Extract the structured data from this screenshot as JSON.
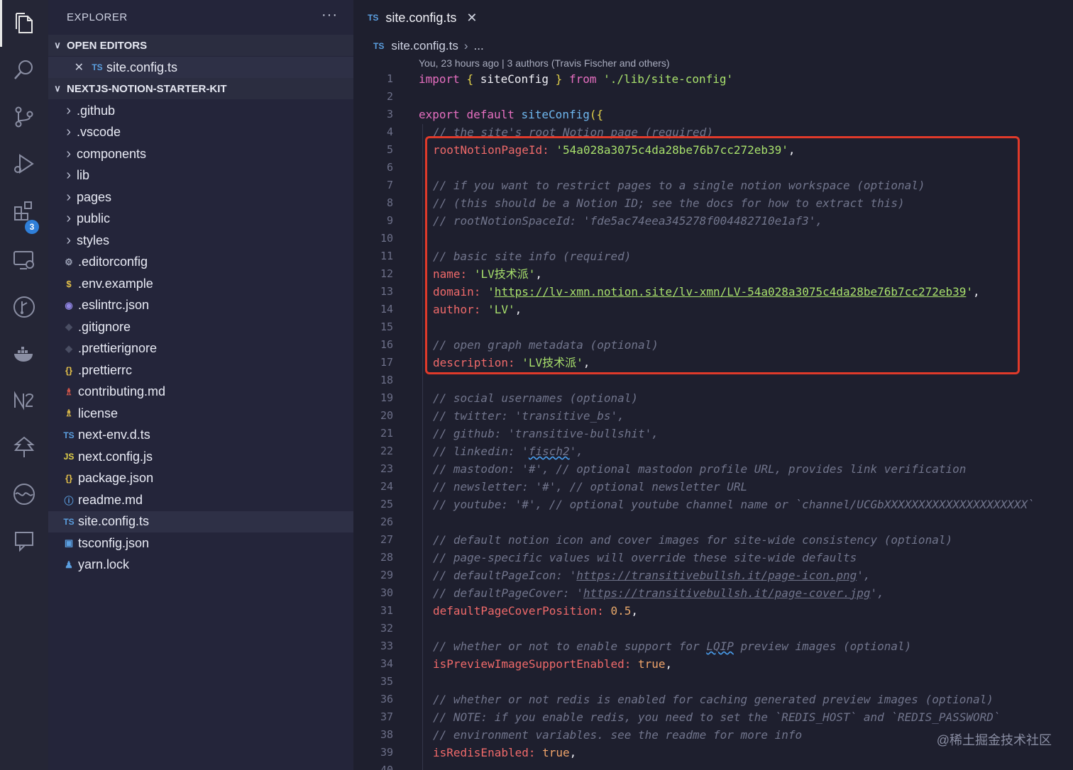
{
  "sidebar": {
    "title": "EXPLORER",
    "more": "···",
    "open_editors_label": "OPEN EDITORS",
    "open_editors": [
      {
        "icon_label": "TS",
        "icon": "typescript-icon",
        "name": "site.config.ts"
      }
    ],
    "project_label": "NEXTJS-NOTION-STARTER-KIT",
    "items": [
      {
        "kind": "folder",
        "name": ".github"
      },
      {
        "kind": "folder",
        "name": ".vscode"
      },
      {
        "kind": "folder",
        "name": "components"
      },
      {
        "kind": "folder",
        "name": "lib"
      },
      {
        "kind": "folder",
        "name": "pages"
      },
      {
        "kind": "folder",
        "name": "public"
      },
      {
        "kind": "folder",
        "name": "styles"
      },
      {
        "kind": "file",
        "icon": "gear-icon",
        "glyph": "⚙",
        "name": ".editorconfig"
      },
      {
        "kind": "file",
        "icon": "dollar-icon",
        "glyph": "$",
        "name": ".env.example"
      },
      {
        "kind": "file",
        "icon": "eslint-icon",
        "glyph": "◉",
        "name": ".eslintrc.json"
      },
      {
        "kind": "file",
        "icon": "git-icon",
        "glyph": "◆",
        "name": ".gitignore"
      },
      {
        "kind": "file",
        "icon": "prettier-icon",
        "glyph": "◆",
        "name": ".prettierignore"
      },
      {
        "kind": "file",
        "icon": "json-icon",
        "glyph": "{}",
        "name": ".prettierrc"
      },
      {
        "kind": "file",
        "icon": "markdown-person-icon",
        "glyph": "♗",
        "name": "contributing.md"
      },
      {
        "kind": "file",
        "icon": "license-icon",
        "glyph": "♗",
        "name": "license"
      },
      {
        "kind": "file",
        "icon": "typescript-icon",
        "glyph": "TS",
        "name": "next-env.d.ts"
      },
      {
        "kind": "file",
        "icon": "javascript-icon",
        "glyph": "JS",
        "name": "next.config.js"
      },
      {
        "kind": "file",
        "icon": "json-icon",
        "glyph": "{}",
        "name": "package.json"
      },
      {
        "kind": "file",
        "icon": "info-icon",
        "glyph": "ⓘ",
        "name": "readme.md"
      },
      {
        "kind": "file",
        "icon": "typescript-icon",
        "glyph": "TS",
        "name": "site.config.ts",
        "selected": true
      },
      {
        "kind": "file",
        "icon": "tsconfig-icon",
        "glyph": "▣",
        "name": "tsconfig.json"
      },
      {
        "kind": "file",
        "icon": "yarn-icon",
        "glyph": "♟",
        "name": "yarn.lock"
      }
    ]
  },
  "activity": {
    "extensions_badge": "3"
  },
  "editor": {
    "tab": {
      "icon_label": "TS",
      "name": "site.config.ts",
      "close": "✕"
    },
    "breadcrumb": {
      "icon_label": "TS",
      "file": "site.config.ts",
      "sep": "›",
      "rest": "..."
    },
    "blame": "You, 23 hours ago | 3 authors (Travis Fischer and others)",
    "lines": [
      {
        "n": "1",
        "indent": 0,
        "tokens": [
          [
            "kw",
            "import"
          ],
          [
            "id",
            " "
          ],
          [
            "br",
            "{"
          ],
          [
            "id",
            " siteConfig "
          ],
          [
            "br",
            "}"
          ],
          [
            "id",
            " "
          ],
          [
            "kw",
            "from"
          ],
          [
            "id",
            " "
          ],
          [
            "str",
            "'./lib/site-config'"
          ]
        ]
      },
      {
        "n": "2",
        "indent": 0,
        "tokens": []
      },
      {
        "n": "3",
        "indent": 0,
        "tokens": [
          [
            "kw",
            "export"
          ],
          [
            "id",
            " "
          ],
          [
            "kw",
            "default"
          ],
          [
            "id",
            " "
          ],
          [
            "fn",
            "siteConfig"
          ],
          [
            "br",
            "({"
          ]
        ]
      },
      {
        "n": "4",
        "indent": 1,
        "tokens": [
          [
            "cm",
            "// the site's root Notion page (required)"
          ]
        ]
      },
      {
        "n": "5",
        "indent": 1,
        "tokens": [
          [
            "prop",
            "rootNotionPageId:"
          ],
          [
            "id",
            " "
          ],
          [
            "str",
            "'54a028a3075c4da28be76b7cc272eb39'"
          ],
          [
            "id",
            ","
          ]
        ]
      },
      {
        "n": "6",
        "indent": 1,
        "tokens": []
      },
      {
        "n": "7",
        "indent": 1,
        "tokens": [
          [
            "cm",
            "// if you want to restrict pages to a single notion workspace (optional)"
          ]
        ]
      },
      {
        "n": "8",
        "indent": 1,
        "tokens": [
          [
            "cm",
            "// (this should be a Notion ID; see the docs for how to extract this)"
          ]
        ]
      },
      {
        "n": "9",
        "indent": 1,
        "tokens": [
          [
            "cm",
            "// rootNotionSpaceId: 'fde5ac74eea345278f004482710e1af3',"
          ]
        ]
      },
      {
        "n": "10",
        "indent": 1,
        "tokens": []
      },
      {
        "n": "11",
        "indent": 1,
        "tokens": [
          [
            "cm",
            "// basic site info (required)"
          ]
        ]
      },
      {
        "n": "12",
        "indent": 1,
        "tokens": [
          [
            "prop",
            "name:"
          ],
          [
            "id",
            " "
          ],
          [
            "str",
            "'LV技术派'"
          ],
          [
            "id",
            ","
          ]
        ]
      },
      {
        "n": "13",
        "indent": 1,
        "tokens": [
          [
            "prop",
            "domain:"
          ],
          [
            "id",
            " "
          ],
          [
            "str",
            "'"
          ],
          [
            "str url",
            "https://lv-xmn.notion.site/lv-xmn/LV-54a028a3075c4da28be76b7cc272eb39"
          ],
          [
            "str",
            "'"
          ],
          [
            "id",
            ","
          ]
        ]
      },
      {
        "n": "14",
        "indent": 1,
        "tokens": [
          [
            "prop",
            "author:"
          ],
          [
            "id",
            " "
          ],
          [
            "str",
            "'LV'"
          ],
          [
            "id",
            ","
          ]
        ]
      },
      {
        "n": "15",
        "indent": 1,
        "tokens": []
      },
      {
        "n": "16",
        "indent": 1,
        "tokens": [
          [
            "cm",
            "// open graph metadata (optional)"
          ]
        ]
      },
      {
        "n": "17",
        "indent": 1,
        "tokens": [
          [
            "prop",
            "description:"
          ],
          [
            "id",
            " "
          ],
          [
            "str",
            "'LV技术派'"
          ],
          [
            "id",
            ","
          ]
        ]
      },
      {
        "n": "18",
        "indent": 1,
        "tokens": []
      },
      {
        "n": "19",
        "indent": 1,
        "tokens": [
          [
            "cm",
            "// social usernames (optional)"
          ]
        ]
      },
      {
        "n": "20",
        "indent": 1,
        "tokens": [
          [
            "cm",
            "// twitter: 'transitive_bs',"
          ]
        ]
      },
      {
        "n": "21",
        "indent": 1,
        "tokens": [
          [
            "cm",
            "// github: 'transitive-bullshit',"
          ]
        ]
      },
      {
        "n": "22",
        "indent": 1,
        "tokens": [
          [
            "cm",
            "// linkedin: '"
          ],
          [
            "cm squig",
            "fisch2"
          ],
          [
            "cm",
            "',"
          ]
        ]
      },
      {
        "n": "23",
        "indent": 1,
        "tokens": [
          [
            "cm",
            "// mastodon: '#', // optional mastodon profile URL, provides link verification"
          ]
        ]
      },
      {
        "n": "24",
        "indent": 1,
        "tokens": [
          [
            "cm",
            "// newsletter: '#', // optional newsletter URL"
          ]
        ]
      },
      {
        "n": "25",
        "indent": 1,
        "tokens": [
          [
            "cm",
            "// youtube: '#', // optional youtube channel name or `channel/UCGbXXXXXXXXXXXXXXXXXXXXX`"
          ]
        ]
      },
      {
        "n": "26",
        "indent": 1,
        "tokens": []
      },
      {
        "n": "27",
        "indent": 1,
        "tokens": [
          [
            "cm",
            "// default notion icon and cover images for site-wide consistency (optional)"
          ]
        ]
      },
      {
        "n": "28",
        "indent": 1,
        "tokens": [
          [
            "cm",
            "// page-specific values will override these site-wide defaults"
          ]
        ]
      },
      {
        "n": "29",
        "indent": 1,
        "tokens": [
          [
            "cm",
            "// defaultPageIcon: '"
          ],
          [
            "cm url",
            "https://transitivebullsh.it/page-icon.png"
          ],
          [
            "cm",
            "',"
          ]
        ]
      },
      {
        "n": "30",
        "indent": 1,
        "tokens": [
          [
            "cm",
            "// defaultPageCover: '"
          ],
          [
            "cm url",
            "https://transitivebullsh.it/page-cover.jpg"
          ],
          [
            "cm",
            "',"
          ]
        ]
      },
      {
        "n": "31",
        "indent": 1,
        "tokens": [
          [
            "prop",
            "defaultPageCoverPosition:"
          ],
          [
            "id",
            " "
          ],
          [
            "num",
            "0.5"
          ],
          [
            "id",
            ","
          ]
        ]
      },
      {
        "n": "32",
        "indent": 1,
        "tokens": []
      },
      {
        "n": "33",
        "indent": 1,
        "tokens": [
          [
            "cm",
            "// whether or not to enable support for "
          ],
          [
            "cm squig",
            "LQIP"
          ],
          [
            "cm",
            " preview images (optional)"
          ]
        ]
      },
      {
        "n": "34",
        "indent": 1,
        "tokens": [
          [
            "prop",
            "isPreviewImageSupportEnabled:"
          ],
          [
            "id",
            " "
          ],
          [
            "bool",
            "true"
          ],
          [
            "id",
            ","
          ]
        ]
      },
      {
        "n": "35",
        "indent": 1,
        "tokens": []
      },
      {
        "n": "36",
        "indent": 1,
        "tokens": [
          [
            "cm",
            "// whether or not redis is enabled for caching generated preview images (optional)"
          ]
        ]
      },
      {
        "n": "37",
        "indent": 1,
        "tokens": [
          [
            "cm",
            "// NOTE: if you enable redis, you need to set the `REDIS_HOST` and `REDIS_PASSWORD`"
          ]
        ]
      },
      {
        "n": "38",
        "indent": 1,
        "tokens": [
          [
            "cm",
            "// environment variables. see the readme for more info"
          ]
        ]
      },
      {
        "n": "39",
        "indent": 1,
        "tokens": [
          [
            "prop",
            "isRedisEnabled:"
          ],
          [
            "id",
            " "
          ],
          [
            "bool",
            "true"
          ],
          [
            "id",
            ","
          ]
        ]
      },
      {
        "n": "40",
        "indent": 1,
        "tokens": []
      }
    ]
  },
  "watermark": "@稀土掘金技术社区"
}
